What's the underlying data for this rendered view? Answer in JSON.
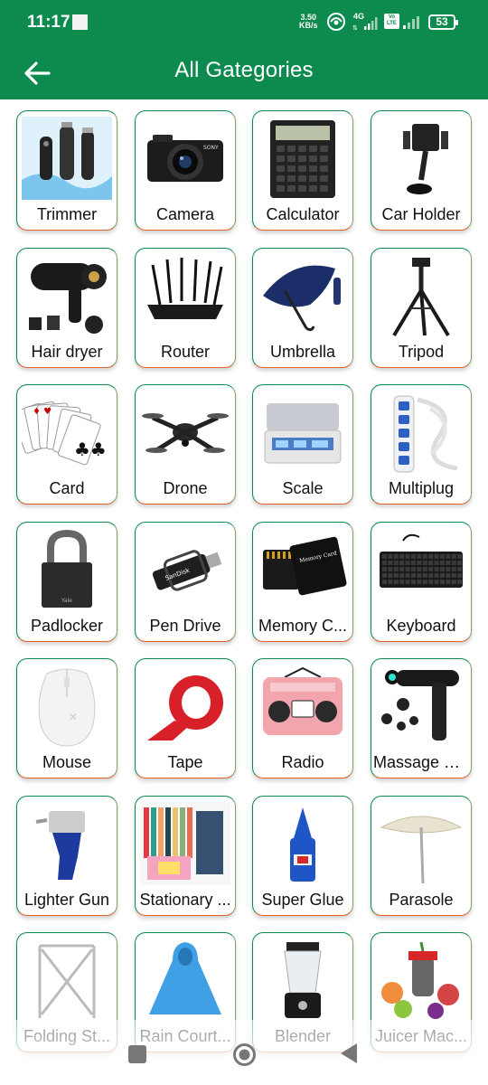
{
  "status_bar": {
    "time": "11:17",
    "net_speed_value": "3.50",
    "net_speed_unit": "KB/s",
    "network_type": "4G",
    "volte": "Vo LTE",
    "battery": "53"
  },
  "header": {
    "title": "All Gategories",
    "back_icon": "arrow-left-icon"
  },
  "categories": [
    {
      "label": "Trimmer",
      "icon": "trimmer-image"
    },
    {
      "label": "Camera",
      "icon": "camera-image"
    },
    {
      "label": "Calculator",
      "icon": "calculator-image"
    },
    {
      "label": "Car Holder",
      "icon": "car-holder-image"
    },
    {
      "label": "Hair dryer",
      "icon": "hair-dryer-image"
    },
    {
      "label": "Router",
      "icon": "router-image"
    },
    {
      "label": "Umbrella",
      "icon": "umbrella-image"
    },
    {
      "label": "Tripod",
      "icon": "tripod-image"
    },
    {
      "label": "Card",
      "icon": "playing-cards-image"
    },
    {
      "label": "Drone",
      "icon": "drone-image"
    },
    {
      "label": "Scale",
      "icon": "scale-image"
    },
    {
      "label": "Multiplug",
      "icon": "multiplug-image"
    },
    {
      "label": "Padlocker",
      "icon": "padlock-image"
    },
    {
      "label": "Pen Drive",
      "icon": "pen-drive-image"
    },
    {
      "label": "Memory C...",
      "icon": "memory-card-image"
    },
    {
      "label": "Keyboard",
      "icon": "keyboard-image"
    },
    {
      "label": "Mouse",
      "icon": "mouse-image"
    },
    {
      "label": "Tape",
      "icon": "tape-image"
    },
    {
      "label": "Radio",
      "icon": "radio-image"
    },
    {
      "label": "Massage G...",
      "icon": "massage-gun-image"
    },
    {
      "label": "Lighter Gun",
      "icon": "lighter-gun-image"
    },
    {
      "label": "Stationary ...",
      "icon": "stationary-image"
    },
    {
      "label": "Super Glue",
      "icon": "super-glue-image"
    },
    {
      "label": "Parasole",
      "icon": "parasol-image"
    },
    {
      "label": "Folding St...",
      "icon": "folding-stand-image"
    },
    {
      "label": "Rain Court...",
      "icon": "raincoat-image"
    },
    {
      "label": "Blender",
      "icon": "blender-image"
    },
    {
      "label": "Juicer Mac...",
      "icon": "juicer-image"
    }
  ],
  "colors": {
    "primary": "#0d8a4e",
    "card_accent": "#e2632a"
  },
  "nav_bar": {
    "recents_icon": "square-icon",
    "home_icon": "circle-icon",
    "back_icon": "triangle-back-icon"
  }
}
